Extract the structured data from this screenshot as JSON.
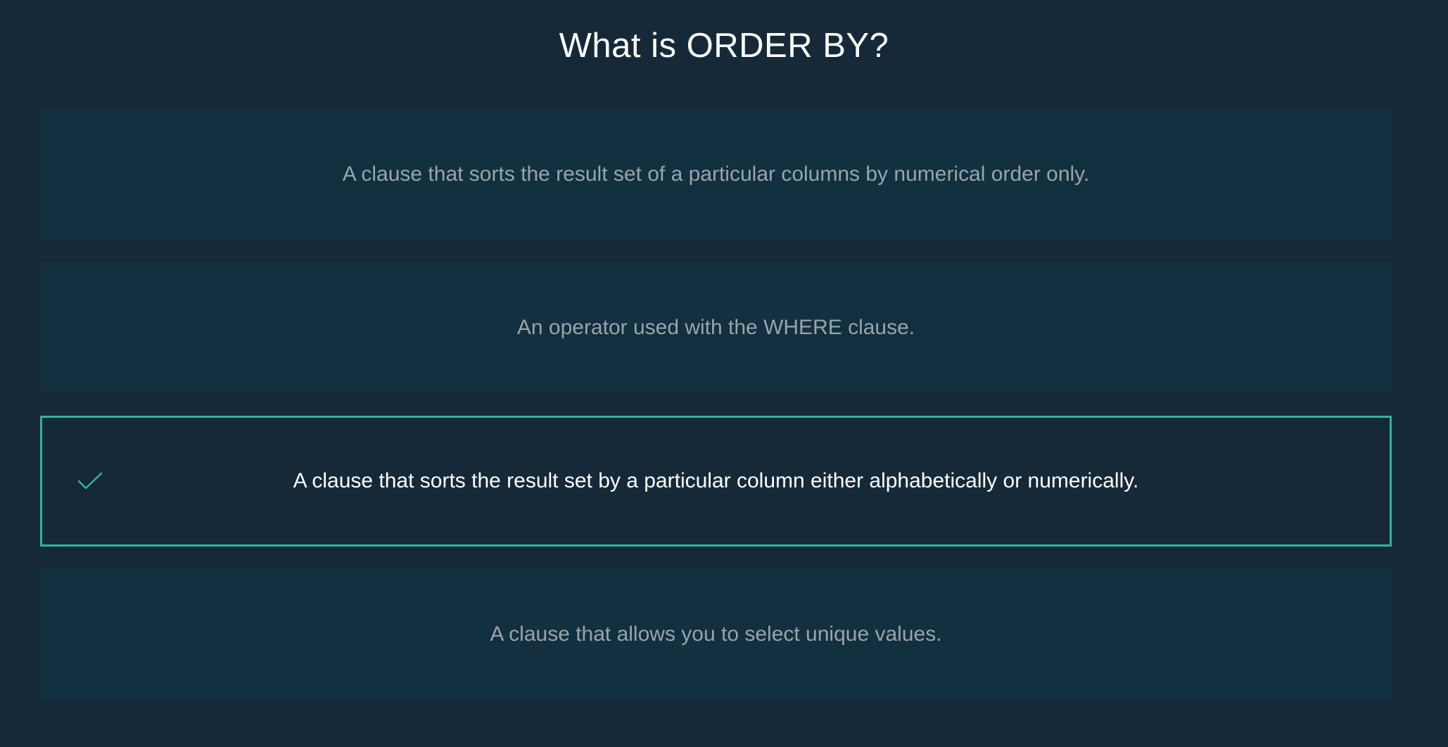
{
  "question": {
    "title": "What is ORDER BY?"
  },
  "options": [
    {
      "label": "A clause that sorts the result set of a particular columns by numerical order only.",
      "selected": false
    },
    {
      "label": "An operator used with the WHERE clause.",
      "selected": false
    },
    {
      "label": "A clause that sorts the result set by a particular column either alphabetically or numerically.",
      "selected": true,
      "icon": "check-icon"
    },
    {
      "label": "A clause that allows you to select unique values.",
      "selected": false
    }
  ],
  "colors": {
    "background": "#162938",
    "option_background": "#12303f",
    "accent": "#2fb3a0",
    "option_text": "#9aa4aa",
    "selected_text": "#ffffff"
  }
}
